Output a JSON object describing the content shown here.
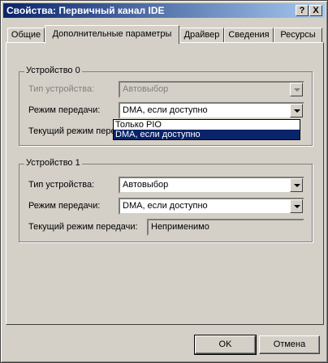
{
  "window": {
    "title": "Свойства: Первичный канал IDE",
    "help_btn": "?",
    "close_btn": "X"
  },
  "tabs": [
    {
      "label": "Общие"
    },
    {
      "label": "Дополнительные параметры"
    },
    {
      "label": "Драйвер"
    },
    {
      "label": "Сведения"
    },
    {
      "label": "Ресурсы"
    }
  ],
  "device0": {
    "legend": "Устройство 0",
    "type_label": "Тип устройства:",
    "type_value": "Автовыбор",
    "mode_label": "Режим передачи:",
    "mode_value": "DMA, если доступно",
    "current_label": "Текущий режим передачи:",
    "dropdown_options": [
      "Только PIO",
      "DMA, если доступно"
    ]
  },
  "device1": {
    "legend": "Устройство 1",
    "type_label": "Тип устройства:",
    "type_value": "Автовыбор",
    "mode_label": "Режим передачи:",
    "mode_value": "DMA, если доступно",
    "current_label": "Текущий режим передачи:",
    "current_value": "Неприменимо"
  },
  "buttons": {
    "ok": "OK",
    "cancel": "Отмена"
  }
}
